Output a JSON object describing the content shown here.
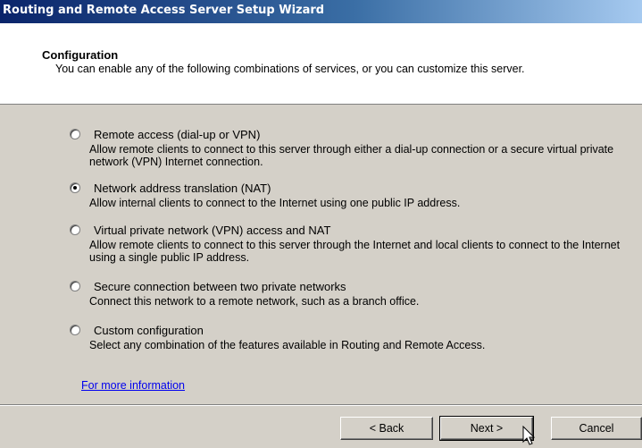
{
  "window": {
    "title": "Routing and Remote Access Server Setup Wizard"
  },
  "header": {
    "title": "Configuration",
    "description": "You can enable any of the following combinations of services, or you can customize this server."
  },
  "options": [
    {
      "label": "Remote access (dial-up or VPN)",
      "description": "Allow remote clients to connect to this server through either a dial-up connection or a secure virtual private network (VPN) Internet connection.",
      "selected": false
    },
    {
      "label": "Network address translation (NAT)",
      "description": "Allow internal clients to connect to the Internet using one public IP address.",
      "selected": true
    },
    {
      "label": "Virtual private network (VPN) access and NAT",
      "description": "Allow remote clients to connect to this server through the Internet and local clients to connect to the Internet using a single public IP address.",
      "selected": false
    },
    {
      "label": "Secure connection between two private networks",
      "description": "Connect this network to a remote network, such as a branch office.",
      "selected": false
    },
    {
      "label": "Custom configuration",
      "description": "Select any combination of the features available in Routing and Remote Access.",
      "selected": false
    }
  ],
  "more_info_link": "For more information",
  "buttons": {
    "back": "< Back",
    "next": "Next >",
    "cancel": "Cancel"
  },
  "icons": {
    "cursor": "mouse-pointer-icon"
  }
}
